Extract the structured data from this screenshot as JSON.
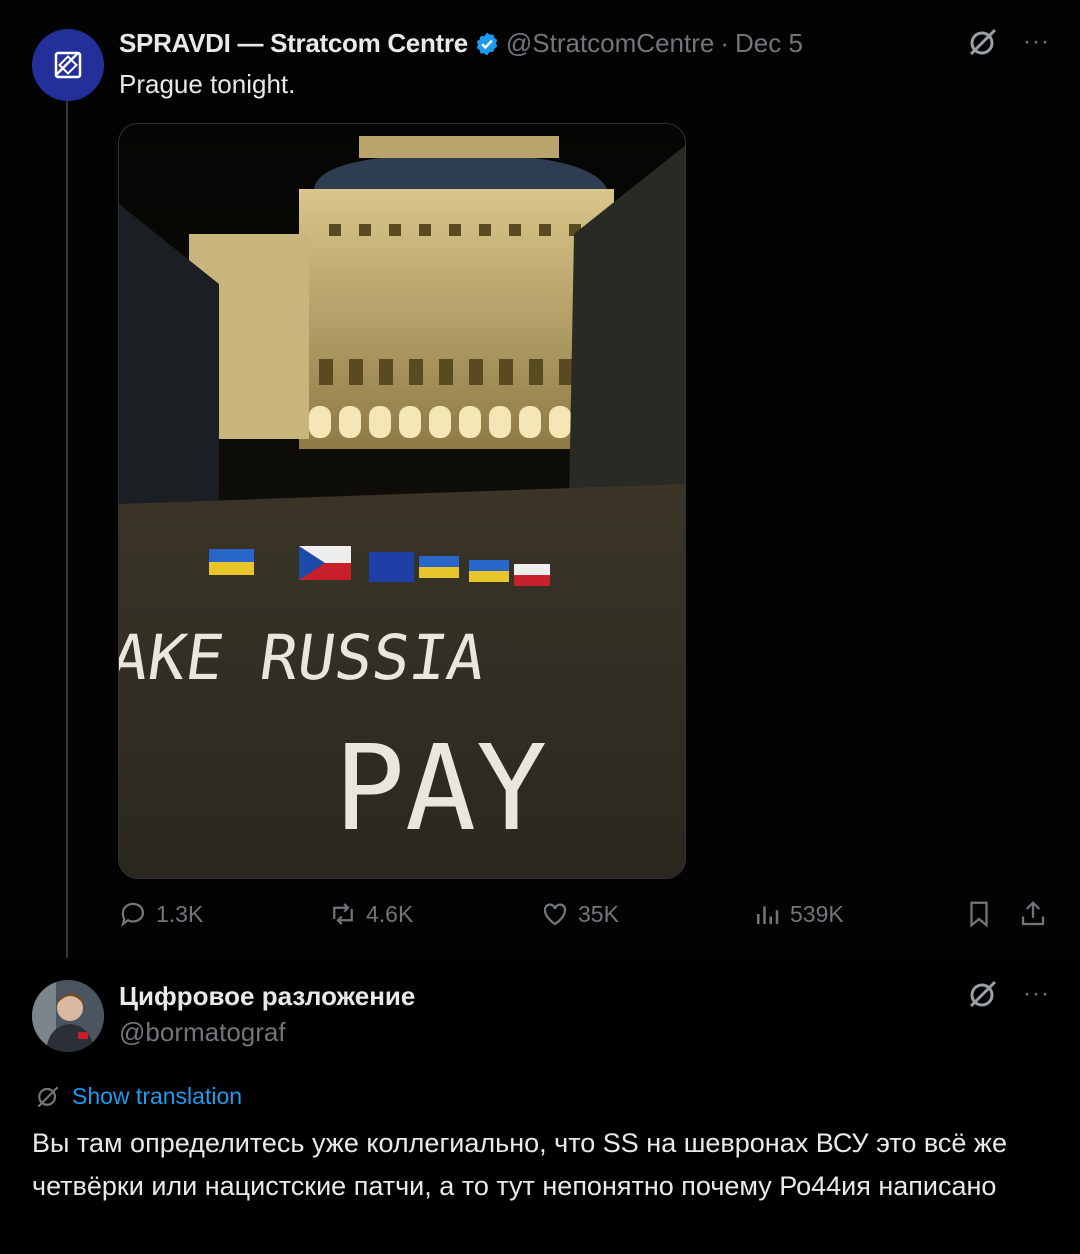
{
  "tweet1": {
    "author_name": "SPRAVDI — Stratcom Centre",
    "handle": "@StratcomCentre",
    "separator": "·",
    "date": "Dec 5",
    "text": "Prague tonight.",
    "photo_text": {
      "line1": "MAKE RUSSIA",
      "line2": "PAY"
    },
    "stats": {
      "replies": "1.3K",
      "reposts": "4.6K",
      "likes": "35K",
      "views": "539K"
    },
    "more_label": "···"
  },
  "tweet2": {
    "author_name": "Цифровое разложение",
    "handle": "@bormatograf",
    "translate_label": "Show translation",
    "text": "Вы там определитесь уже коллегиально, что SS на шевронах ВСУ это всё же четвёрки или нацистские патчи, а то тут непонятно почему Ро44ия написано",
    "more_label": "···"
  },
  "colors": {
    "background": "#000000",
    "accent": "#1d9bf0",
    "muted": "#71767b",
    "verified": "#1d9bf0",
    "avatar1": "#24309a"
  },
  "icons": [
    "grok-icon",
    "more-icon",
    "reply-icon",
    "repost-icon",
    "like-icon",
    "views-icon",
    "bookmark-icon",
    "share-icon",
    "translate-icon",
    "verified-icon"
  ]
}
